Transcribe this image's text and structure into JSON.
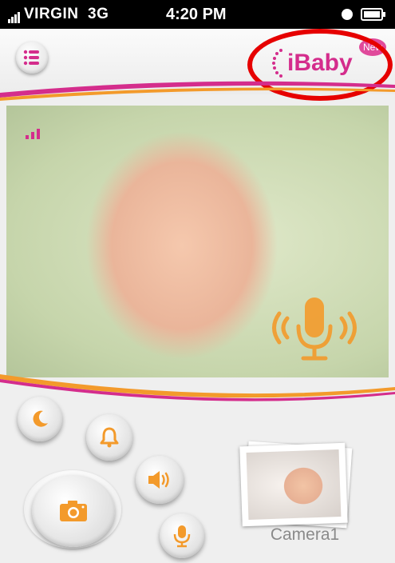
{
  "status_bar": {
    "carrier": "VIRGIN",
    "network": "3G",
    "time": "4:20 PM"
  },
  "header": {
    "logo_text": "iBaby",
    "new_badge": "New",
    "menu_icon": "list-icon"
  },
  "video": {
    "signal_icon": "signal-strength-icon",
    "talk_overlay_icon": "microphone-broadcast-icon"
  },
  "controls": [
    {
      "name": "night-mode-button",
      "icon": "moon-icon"
    },
    {
      "name": "alarm-button",
      "icon": "bell-icon"
    },
    {
      "name": "speaker-button",
      "icon": "speaker-icon"
    },
    {
      "name": "talk-button",
      "icon": "microphone-icon"
    },
    {
      "name": "snapshot-button",
      "icon": "camera-icon"
    }
  ],
  "camera": {
    "label": "Camera1"
  },
  "colors": {
    "accent_orange": "#f39a2b",
    "brand_pink": "#d42d8c",
    "highlight_red": "#e60000"
  }
}
